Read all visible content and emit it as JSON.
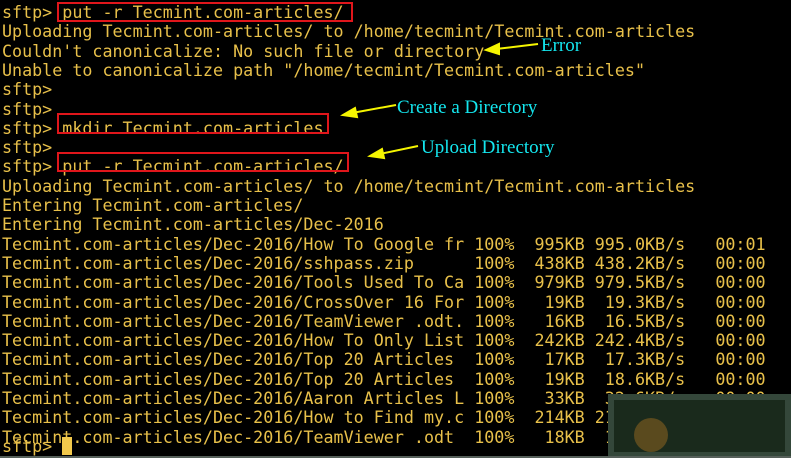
{
  "terminal": {
    "prompt": "sftp>",
    "lines": [
      "sftp> put -r Tecmint.com-articles/",
      "Uploading Tecmint.com-articles/ to /home/tecmint/Tecmint.com-articles",
      "Couldn't canonicalize: No such file or directory",
      "Unable to canonicalize path \"/home/tecmint/Tecmint.com-articles\"",
      "sftp>",
      "sftp>",
      "sftp> mkdir Tecmint.com-articles",
      "sftp>",
      "sftp> put -r Tecmint.com-articles/",
      "Uploading Tecmint.com-articles/ to /home/tecmint/Tecmint.com-articles",
      "Entering Tecmint.com-articles/",
      "Entering Tecmint.com-articles/Dec-2016",
      "Tecmint.com-articles/Dec-2016/How To Google fr 100%  995KB 995.0KB/s   00:01",
      "Tecmint.com-articles/Dec-2016/sshpass.zip      100%  438KB 438.2KB/s   00:00",
      "Tecmint.com-articles/Dec-2016/Tools Used To Ca 100%  979KB 979.5KB/s   00:00",
      "Tecmint.com-articles/Dec-2016/CrossOver 16 For 100%   19KB  19.3KB/s   00:00",
      "Tecmint.com-articles/Dec-2016/TeamViewer .odt. 100%   16KB  16.5KB/s   00:00",
      "Tecmint.com-articles/Dec-2016/How To Only List 100%  242KB 242.4KB/s   00:00",
      "Tecmint.com-articles/Dec-2016/Top 20 Articles  100%   17KB  17.3KB/s   00:00",
      "Tecmint.com-articles/Dec-2016/Top 20 Articles  100%   19KB  18.6KB/s   00:00",
      "Tecmint.com-articles/Dec-2016/Aaron Articles L 100%   33KB  32.6KB/s   00:00",
      "Tecmint.com-articles/Dec-2016/How to Find my.c 100%  214KB 213.7KB/s   00:00",
      "Tecmint.com-articles/Dec-2016/TeamViewer .odt  100%   18KB  17.8KB/s   00:00"
    ]
  },
  "annotations": {
    "error": "Error",
    "create": "Create a Directory",
    "upload": "Upload Directory"
  },
  "colors": {
    "text": "#e8c04a",
    "highlight": "#e0161b",
    "annotation": "#14e6ee",
    "arrow": "#f5f500"
  }
}
